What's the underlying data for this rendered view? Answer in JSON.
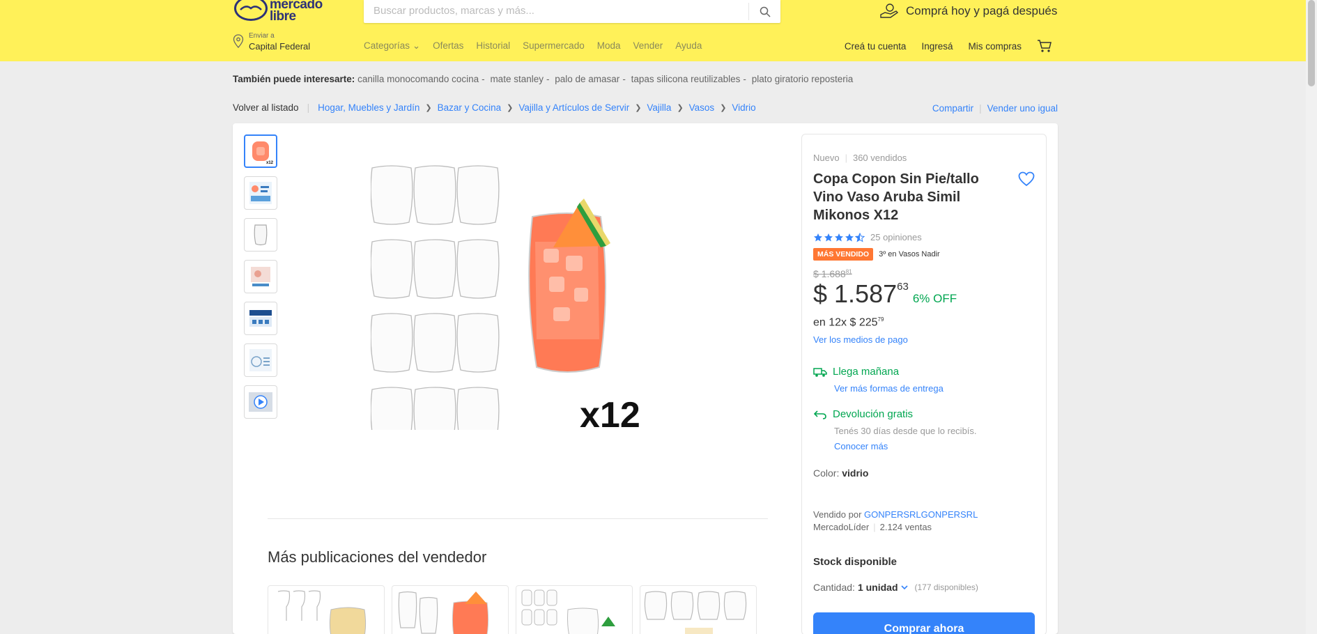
{
  "header": {
    "logo_line1": "mercado",
    "logo_line2": "libre",
    "search_placeholder": "Buscar productos, marcas y más...",
    "promo": "Comprá hoy y pagá después",
    "location_label": "Enviar a",
    "location_value": "Capital Federal",
    "nav": [
      "Categorías",
      "Ofertas",
      "Historial",
      "Supermercado",
      "Moda",
      "Vender",
      "Ayuda"
    ],
    "account": [
      "Creá tu cuenta",
      "Ingresá",
      "Mis compras"
    ],
    "bg_color": "#fff159"
  },
  "suggestions": {
    "label": "También puede interesarte:",
    "items": [
      "canilla monocomando cocina",
      "mate stanley",
      "palo de amasar",
      "tapas silicona reutilizables",
      "plato giratorio reposteria"
    ]
  },
  "breadcrumb": {
    "back": "Volver al listado",
    "items": [
      "Hogar, Muebles y Jardín",
      "Bazar y Cocina",
      "Vajilla y Artículos de Servir",
      "Vajilla",
      "Vasos",
      "Vidrio"
    ],
    "share": "Compartir",
    "sell_same": "Vender uno igual"
  },
  "gallery": {
    "thumb_icons": [
      "product-photo-icon",
      "infographic-icon",
      "glass-icon",
      "set-icon",
      "brand-banner-icon",
      "specs-icon",
      "video-icon"
    ],
    "main_overlay_text": "x12",
    "more_title": "Más publicaciones del vendedor"
  },
  "product": {
    "condition": "Nuevo",
    "sold": "360 vendidos",
    "title": "Copa Copon Sin Pie/tallo Vino Vaso Aruba Simil Mikonos X12",
    "rating": 4.5,
    "reviews": "25 opiniones",
    "badge": "MÁS VENDIDO",
    "rank": "3º en Vasos Nadir",
    "old_price_int": "$ 1.688",
    "old_price_cents": "81",
    "price_int": "$ 1.587",
    "price_cents": "63",
    "discount": "6% OFF",
    "installments_text": "en 12x $ 225",
    "installments_cents": "79",
    "pay_link": "Ver los medios de pago",
    "shipping_title": "Llega mañana",
    "shipping_link": "Ver más formas de entrega",
    "return_title": "Devolución gratis",
    "return_desc": "Tenés 30 días desde que lo recibís.",
    "return_link": "Conocer más",
    "color_label": "Color:",
    "color_value": "vidrio",
    "seller_label": "Vendido por",
    "seller_name": "GONPERSRLGONPERSRL",
    "leader": "MercadoLíder",
    "sales": "2.124 ventas",
    "stock": "Stock disponible",
    "qty_label": "Cantidad:",
    "qty_value": "1 unidad",
    "qty_available": "(177 disponibles)",
    "buy_button": "Comprar ahora",
    "accent_color": "#3483fa",
    "green_color": "#00a650"
  }
}
